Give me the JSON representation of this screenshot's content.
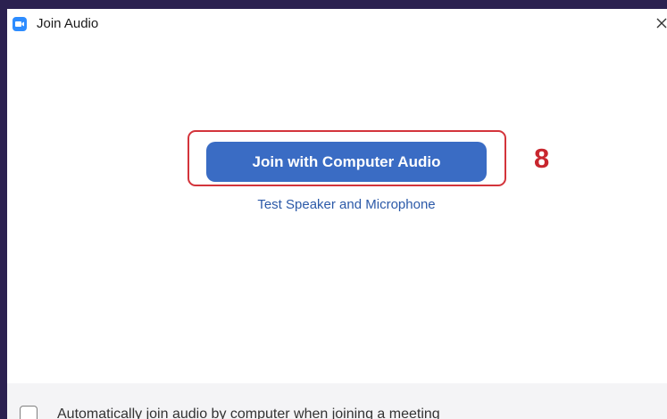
{
  "window": {
    "title": "Join Audio"
  },
  "main": {
    "join_button_label": "Join with Computer Audio",
    "test_link_label": "Test Speaker and Microphone",
    "step_annotation": "8"
  },
  "footer": {
    "auto_join_label": "Automatically join audio by computer when joining a meeting",
    "auto_join_checked": false
  },
  "colors": {
    "accent": "#3a6cc4",
    "link": "#2b59a8",
    "annotation": "#c8262e",
    "app_icon": "#2d8cff"
  },
  "icons": {
    "app": "zoom-camera-icon",
    "close": "close-icon"
  }
}
